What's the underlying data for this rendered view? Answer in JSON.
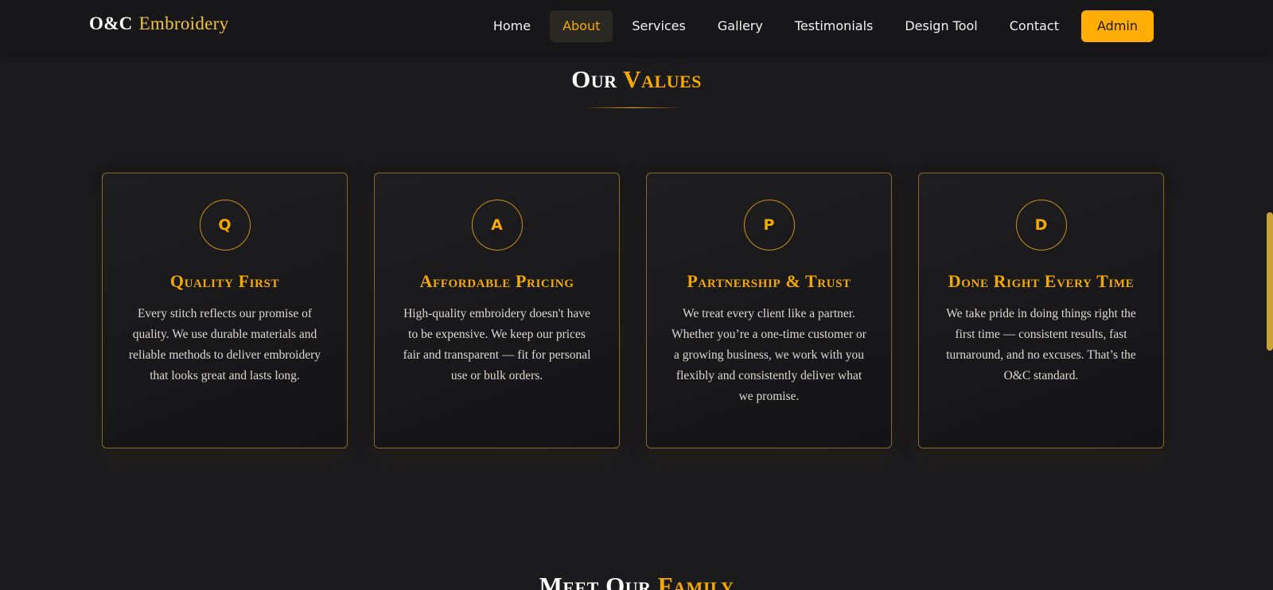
{
  "nav": {
    "brand_main": "O&C",
    "brand_accent": "Embroidery",
    "items": [
      {
        "label": "Home"
      },
      {
        "label": "About"
      },
      {
        "label": "Services"
      },
      {
        "label": "Gallery"
      },
      {
        "label": "Testimonials"
      },
      {
        "label": "Design Tool"
      },
      {
        "label": "Contact"
      }
    ],
    "active_item": "About",
    "admin_label": "Admin"
  },
  "values_section": {
    "title_part1": "Our",
    "title_part2": "Values",
    "cards": [
      {
        "icon_letter": "Q",
        "title": "Quality First",
        "text": "Every stitch reflects our promise of quality. We use durable materials and reliable methods to deliver embroidery that looks great and lasts long."
      },
      {
        "icon_letter": "A",
        "title": "Affordable Pricing",
        "text": "High-quality embroidery doesn't have to be expensive. We keep our prices fair and transparent — fit for personal use or bulk orders."
      },
      {
        "icon_letter": "P",
        "title": "Partnership & Trust",
        "text": "We treat every client like a partner. Whether you’re a one-time customer or a growing business, we work with you flexibly and consistently deliver what we promise."
      },
      {
        "icon_letter": "D",
        "title": "Done Right Every Time",
        "text": "We take pride in doing things right the first time — consistent results, fast turnaround, and no excuses. That’s the O&C standard."
      }
    ]
  },
  "next_section": {
    "title_part1": "Meet Our",
    "title_part2": "Family"
  },
  "colors": {
    "accent": "#f5a800",
    "background": "#1b1b1e",
    "admin_button": "#ffad05"
  }
}
